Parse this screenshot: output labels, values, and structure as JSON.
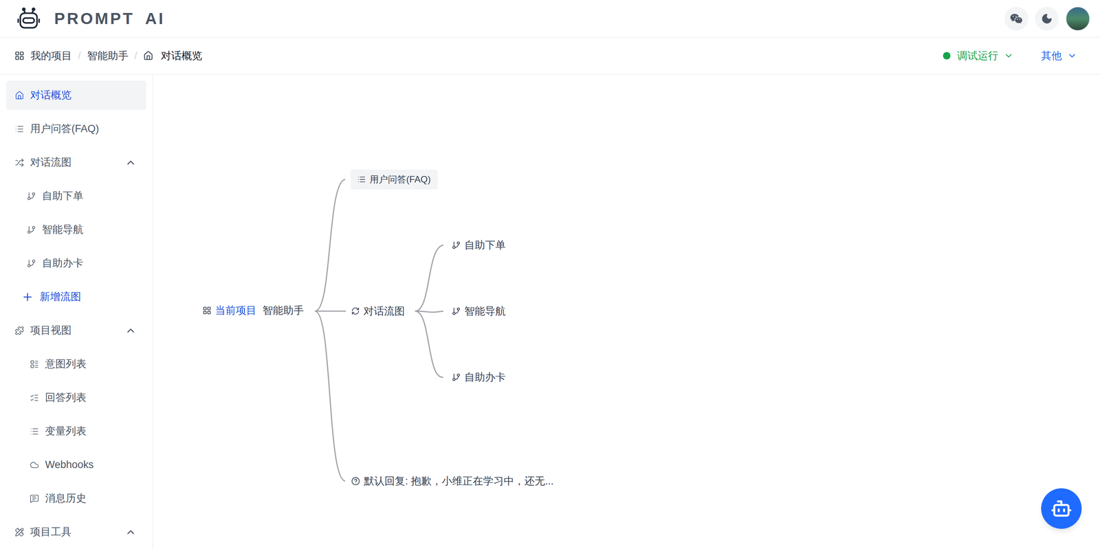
{
  "header": {
    "title": "PROMPT AI"
  },
  "breadcrumb": {
    "separator": "/",
    "items": [
      {
        "label": "我的项目"
      },
      {
        "label": "智能助手"
      },
      {
        "label": "对话概览"
      }
    ]
  },
  "actions": [
    {
      "label": "调试运行",
      "color": "#16a34a"
    },
    {
      "label": "其他",
      "color": "#2563eb"
    }
  ],
  "sidebar": {
    "items": [
      {
        "label": "对话概览",
        "kind": "item",
        "selected": true
      },
      {
        "label": "用户问答(FAQ)",
        "kind": "item",
        "selected": false
      },
      {
        "label": "对话流图",
        "kind": "group",
        "expanded": true
      },
      {
        "label": "自助下单",
        "kind": "flow",
        "selected": false
      },
      {
        "label": "智能导航",
        "kind": "flow",
        "selected": false
      },
      {
        "label": "自助办卡",
        "kind": "flow",
        "selected": false
      },
      {
        "label": "新增流图",
        "kind": "add"
      },
      {
        "label": "项目视图",
        "kind": "group",
        "expanded": true
      },
      {
        "label": "意图列表",
        "kind": "view",
        "selected": false
      },
      {
        "label": "回答列表",
        "kind": "view",
        "selected": false
      },
      {
        "label": "变量列表",
        "kind": "view",
        "selected": false
      },
      {
        "label": "Webhooks",
        "kind": "view",
        "selected": false
      },
      {
        "label": "消息历史",
        "kind": "view",
        "selected": false
      },
      {
        "label": "项目工具",
        "kind": "group",
        "expanded": true
      }
    ]
  },
  "diagram": {
    "root": {
      "tag": "当前项目",
      "label": "智能助手"
    },
    "faq": {
      "label": "用户问答(FAQ)"
    },
    "flows": {
      "label": "对话流图",
      "children": [
        {
          "label": "自助下单"
        },
        {
          "label": "智能导航"
        },
        {
          "label": "自助办卡"
        }
      ]
    },
    "fallback": {
      "label": "默认回复: 抱歉，小维正在学习中，还无..."
    }
  }
}
